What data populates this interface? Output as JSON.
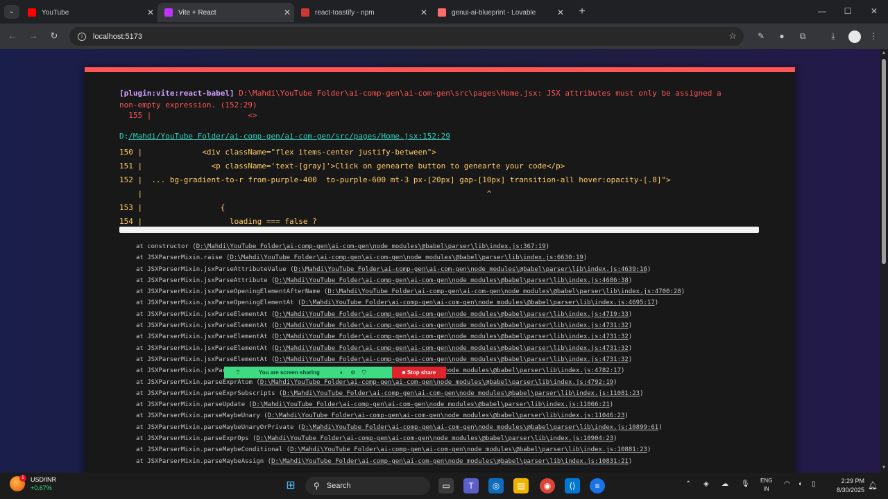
{
  "browser": {
    "tabs": [
      {
        "title": "YouTube",
        "color": "#ff0000",
        "active": false
      },
      {
        "title": "Vite + React",
        "color": "#bd34fe",
        "active": true
      },
      {
        "title": "react-toastify - npm",
        "color": "#cb3837",
        "active": false
      },
      {
        "title": "genui-ai-blueprint - Lovable",
        "color": "#ff6b6b",
        "active": false
      }
    ],
    "url": "localhost:5173",
    "icons": {
      "tab_search": "chevron-down-icon",
      "back": "back-arrow-icon",
      "forward": "forward-arrow-icon",
      "reload": "reload-icon",
      "bookmark": "star-icon"
    }
  },
  "error_overlay": {
    "accent_color": "#ff5555",
    "plugin": "[plugin:vite:react-babel]",
    "message": "D:\\Mahdi\\YouTube Folder\\ai-comp-gen\\ai-com-gen\\src\\pages\\Home.jsx: JSX attributes must only be assigned a non-empty expression. (152:29)",
    "message_line": "  155 |                     <>",
    "file_prefix": "D:",
    "file_link": "/Mahdi/YouTube Folder/ai-comp-gen/ai-com-gen/src/pages/Home.jsx:152:29",
    "frame_lines": [
      "150 |             <div className=\"flex items-center justify-between\">",
      "151 |               <p className='text-[gray]'>Click on genearte button to genearte your code</p>",
      "152 |  ... bg-gradient-to-r from-purple-400  to-purple-600 mt-3 px-[20px] gap-[10px] transition-all hover:opacity-[.8]\">",
      "    |                                                                           ^",
      "153 |                 {",
      "154 |                   loading === false ?"
    ],
    "stack": [
      {
        "fn": "at constructor",
        "loc": "D:\\Mahdi\\YouTube Folder\\ai-comp-gen\\ai-com-gen\\node_modules\\@babel\\parser\\lib\\index.js:367:19"
      },
      {
        "fn": "at JSXParserMixin.raise",
        "loc": "D:\\Mahdi\\YouTube Folder\\ai-comp-gen\\ai-com-gen\\node_modules\\@babel\\parser\\lib\\index.js:6630:19"
      },
      {
        "fn": "at JSXParserMixin.jsxParseAttributeValue",
        "loc": "D:\\Mahdi\\YouTube Folder\\ai-comp-gen\\ai-com-gen\\node_modules\\@babel\\parser\\lib\\index.js:4639:16"
      },
      {
        "fn": "at JSXParserMixin.jsxParseAttribute",
        "loc": "D:\\Mahdi\\YouTube Folder\\ai-comp-gen\\ai-com-gen\\node_modules\\@babel\\parser\\lib\\index.js:4686:38"
      },
      {
        "fn": "at JSXParserMixin.jsxParseOpeningElementAfterName",
        "loc": "D:\\Mahdi\\YouTube Folder\\ai-comp-gen\\ai-com-gen\\node_modules\\@babel\\parser\\lib\\index.js:4700:28"
      },
      {
        "fn": "at JSXParserMixin.jsxParseOpeningElementAt",
        "loc": "D:\\Mahdi\\YouTube Folder\\ai-comp-gen\\ai-com-gen\\node_modules\\@babel\\parser\\lib\\index.js:4695:17"
      },
      {
        "fn": "at JSXParserMixin.jsxParseElementAt",
        "loc": "D:\\Mahdi\\YouTube Folder\\ai-comp-gen\\ai-com-gen\\node_modules\\@babel\\parser\\lib\\index.js:4719:33"
      },
      {
        "fn": "at JSXParserMixin.jsxParseElementAt",
        "loc": "D:\\Mahdi\\YouTube Folder\\ai-comp-gen\\ai-com-gen\\node_modules\\@babel\\parser\\lib\\index.js:4731:32"
      },
      {
        "fn": "at JSXParserMixin.jsxParseElementAt",
        "loc": "D:\\Mahdi\\YouTube Folder\\ai-comp-gen\\ai-com-gen\\node_modules\\@babel\\parser\\lib\\index.js:4731:32"
      },
      {
        "fn": "at JSXParserMixin.jsxParseElementAt",
        "loc": "D:\\Mahdi\\YouTube Folder\\ai-comp-gen\\ai-com-gen\\node_modules\\@babel\\parser\\lib\\index.js:4731:32"
      },
      {
        "fn": "at JSXParserMixin.jsxParseElementAt",
        "loc": "D:\\Mahdi\\YouTube Folder\\ai-comp-gen\\ai-com-gen\\node_modules\\@babel\\parser\\lib\\index.js:4731:32"
      },
      {
        "fn": "at JSXParserMixin.jsxParseElement",
        "loc": "D:\\Mahdi\\YouTube Folder\\ai-comp-gen\\ai-com-gen\\node_modules\\@babel\\parser\\lib\\index.js:4782:17"
      },
      {
        "fn": "at JSXParserMixin.parseExprAtom",
        "loc": "D:\\Mahdi\\YouTube Folder\\ai-comp-gen\\ai-com-gen\\node_modules\\@babel\\parser\\lib\\index.js:4792:19"
      },
      {
        "fn": "at JSXParserMixin.parseExprSubscripts",
        "loc": "D:\\Mahdi\\YouTube Folder\\ai-comp-gen\\ai-com-gen\\node_modules\\@babel\\parser\\lib\\index.js:11081:23"
      },
      {
        "fn": "at JSXParserMixin.parseUpdate",
        "loc": "D:\\Mahdi\\YouTube Folder\\ai-comp-gen\\ai-com-gen\\node_modules\\@babel\\parser\\lib\\index.js:11066:21"
      },
      {
        "fn": "at JSXParserMixin.parseMaybeUnary",
        "loc": "D:\\Mahdi\\YouTube Folder\\ai-comp-gen\\ai-com-gen\\node_modules\\@babel\\parser\\lib\\index.js:11046:23"
      },
      {
        "fn": "at JSXParserMixin.parseMaybeUnaryOrPrivate",
        "loc": "D:\\Mahdi\\YouTube Folder\\ai-comp-gen\\ai-com-gen\\node_modules\\@babel\\parser\\lib\\index.js:10899:61"
      },
      {
        "fn": "at JSXParserMixin.parseExprOps",
        "loc": "D:\\Mahdi\\YouTube Folder\\ai-comp-gen\\ai-com-gen\\node_modules\\@babel\\parser\\lib\\index.js:10904:23"
      },
      {
        "fn": "at JSXParserMixin.parseMaybeConditional",
        "loc": "D:\\Mahdi\\YouTube Folder\\ai-comp-gen\\ai-com-gen\\node_modules\\@babel\\parser\\lib\\index.js:10881:23"
      },
      {
        "fn": "at JSXParserMixin.parseMaybeAssign",
        "loc": "D:\\Mahdi\\YouTube Folder\\ai-comp-gen\\ai-com-gen\\node_modules\\@babel\\parser\\lib\\index.js:10831:21"
      }
    ]
  },
  "screen_share": {
    "label": "You are screen sharing",
    "stop_label": "Stop share",
    "color": "#3ddc84",
    "stop_color": "#e0242c"
  },
  "taskbar": {
    "ticker": "USD/INR",
    "ticker_change": "+0.67%",
    "badge": "1",
    "search_placeholder": "Search",
    "lang_top": "ENG",
    "lang_bottom": "IN",
    "time": "2:29 PM",
    "date": "8/30/2025"
  }
}
